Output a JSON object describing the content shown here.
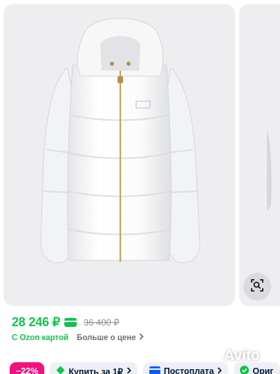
{
  "product": {
    "price": "28 246 ₽",
    "old_price": "36 400 ₽",
    "ozon_card_label": "С Ozon картой",
    "more_about_price": "Больше о цене"
  },
  "chips": {
    "discount": "−22%",
    "buy_for": "Купить за 1₽",
    "postpay": "Постоплата",
    "original": "Ориг"
  },
  "watermark": "Avito",
  "icons": [
    "card-icon",
    "chevron-right-icon",
    "diamond-icon",
    "card-blue-icon",
    "visual-search-icon",
    "avito-logo-icon"
  ],
  "colors": {
    "price_green": "#10c44c",
    "discount_pink": "#f1117e",
    "chip_bg": "#eef0f5",
    "photo_bg": "#eeeef0"
  }
}
